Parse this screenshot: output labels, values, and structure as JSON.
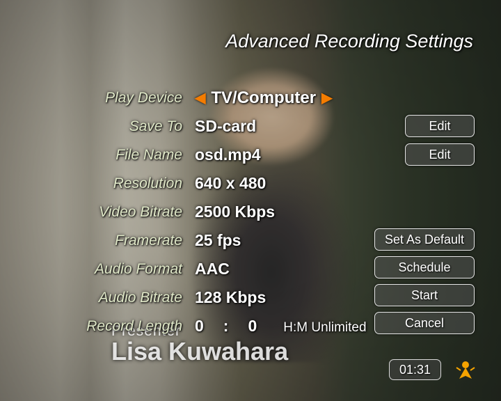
{
  "title": "Advanced Recording Settings",
  "rows": {
    "play_device": {
      "label": "Play Device",
      "value": "TV/Computer"
    },
    "save_to": {
      "label": "Save To",
      "value": "SD-card"
    },
    "file_name": {
      "label": "File Name",
      "value": "osd.mp4"
    },
    "resolution": {
      "label": "Resolution",
      "value": "640 x 480"
    },
    "video_bitrate": {
      "label": "Video Bitrate",
      "value": "2500 Kbps"
    },
    "framerate": {
      "label": "Framerate",
      "value": "25 fps"
    },
    "audio_format": {
      "label": "Audio Format",
      "value": "AAC"
    },
    "audio_bitrate": {
      "label": "Audio Bitrate",
      "value": "128 Kbps"
    },
    "record_length": {
      "label": "Record Length",
      "h": "0",
      "sep": ":",
      "m": "0",
      "suffix": "H:M Unlimited"
    }
  },
  "buttons": {
    "edit1": "Edit",
    "edit2": "Edit",
    "set_default": "Set As Default",
    "schedule": "Schedule",
    "start": "Start",
    "cancel": "Cancel"
  },
  "clock": "01:31",
  "lower_third": {
    "role": "Presenter",
    "name": "Lisa Kuwahara"
  }
}
